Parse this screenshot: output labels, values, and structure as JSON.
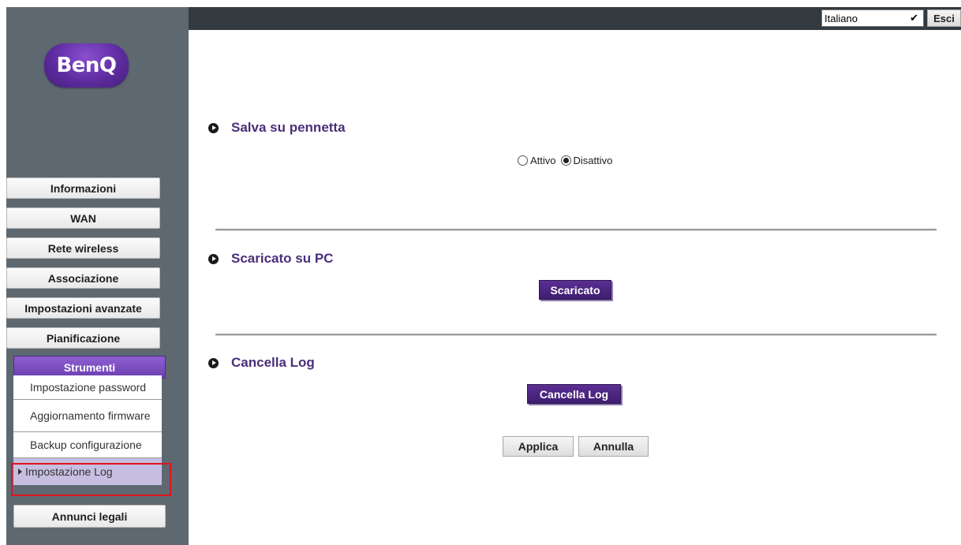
{
  "brand": {
    "logo_text": "BenQ"
  },
  "topbar": {
    "language_value": "Italiano",
    "language_options": [
      "Italiano"
    ],
    "logout_label": "Esci"
  },
  "nav": {
    "items": [
      {
        "label": "Informazioni"
      },
      {
        "label": "WAN"
      },
      {
        "label": "Rete wireless"
      },
      {
        "label": "Associazione"
      },
      {
        "label": "Impostazioni avanzate"
      },
      {
        "label": "Pianificazione"
      },
      {
        "label": "Strumenti",
        "active": true
      },
      {
        "label": "Annunci legali"
      }
    ],
    "submenu": [
      {
        "label": "Impostazione password"
      },
      {
        "label": "Aggiornamento firmware"
      },
      {
        "label": "Backup configurazione"
      },
      {
        "label": "Impostazione Log",
        "selected": true
      }
    ]
  },
  "sections": {
    "usb": {
      "title": "Salva su pennetta",
      "options": [
        {
          "label": "Attivo",
          "checked": false
        },
        {
          "label": "Disattivo",
          "checked": true
        }
      ]
    },
    "download": {
      "title": "Scaricato su PC",
      "button_label": "Scaricato"
    },
    "clear": {
      "title": "Cancella Log",
      "button_label": "Cancella Log"
    }
  },
  "actions": {
    "apply_label": "Applica",
    "cancel_label": "Annulla"
  },
  "colors": {
    "sidebar_bg": "#5e6870",
    "topbar_bg": "#333a40",
    "accent_purple": "#4a2f7a",
    "active_tab": "#7a4cc0",
    "selected_item": "#c7bfe2",
    "highlight_border": "#e0141e"
  }
}
